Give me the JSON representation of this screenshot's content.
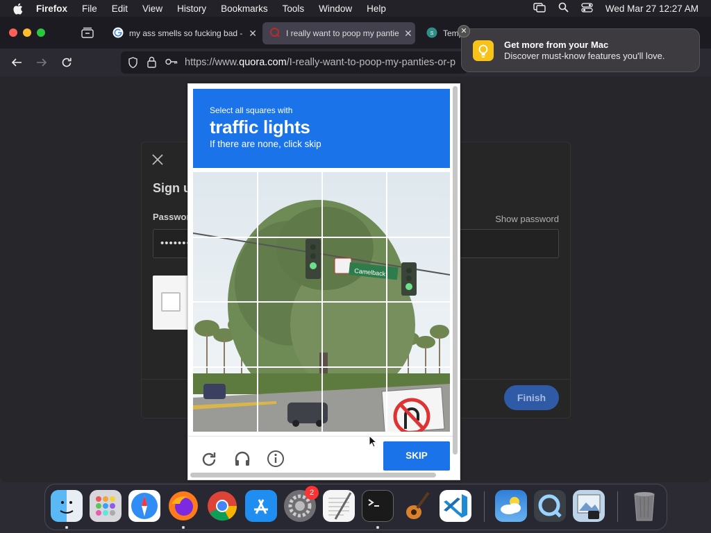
{
  "menubar": {
    "items": [
      "Firefox",
      "File",
      "Edit",
      "View",
      "History",
      "Bookmarks",
      "Tools",
      "Window",
      "Help"
    ],
    "datetime": "Wed Mar 27  12:27 AM"
  },
  "tabs": [
    {
      "label": "my ass smells so fucking bad - (",
      "favicon": "google-icon"
    },
    {
      "label": "I really want to poop my panties",
      "favicon": "quora-icon"
    },
    {
      "label": "Temp",
      "favicon": "temp-mail-icon"
    }
  ],
  "navbar": {
    "url_prefix": "https://www.",
    "url_domain": "quora.com",
    "url_path": "/I-really-want-to-poop-my-panties-or-p"
  },
  "modal": {
    "title": "Sign u",
    "password_label": "Passwor",
    "show_password": "Show password",
    "password_value": "•••••••",
    "finish_label": "Finish"
  },
  "captcha": {
    "instruction_line1": "Select all squares with",
    "target_object": "traffic lights",
    "instruction_line3": "If there are none, click skip",
    "skip_label": "SKIP",
    "grid_size": "4x4",
    "sign_text": "Camelback"
  },
  "notification": {
    "title": "Get more from your Mac",
    "body": "Discover must-know features you'll love."
  },
  "dock": {
    "apps": [
      "Finder",
      "Launchpad",
      "Safari",
      "Firefox",
      "Chrome",
      "App Store",
      "System Settings",
      "TextEdit",
      "Terminal",
      "GarageBand",
      "VS Code",
      "Weather",
      "QuickTime",
      "Preview",
      "Trash"
    ],
    "settings_badge": "2"
  },
  "colors": {
    "accent": "#1a73e8",
    "finish_button": "#2e5aa6",
    "notification_icon": "#f7c31a"
  }
}
